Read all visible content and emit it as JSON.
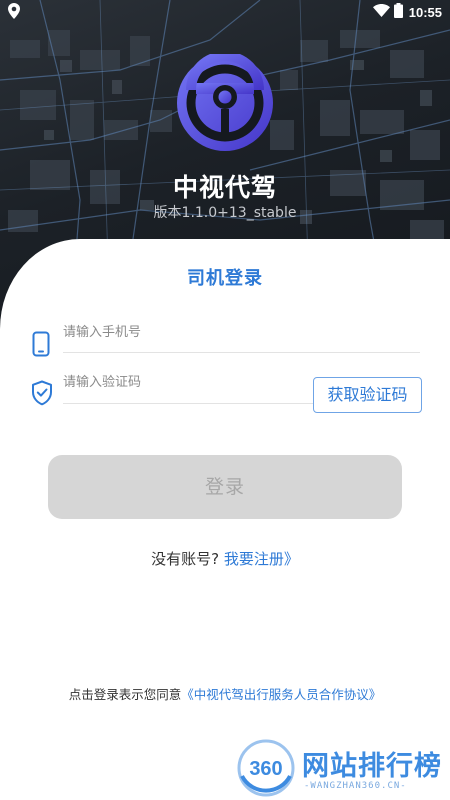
{
  "status_bar": {
    "time": "10:55",
    "icons": [
      "location-icon",
      "wifi-icon",
      "battery-icon"
    ]
  },
  "header": {
    "app_name": "中视代驾",
    "version": "版本1.1.0+13_stable"
  },
  "login": {
    "title": "司机登录",
    "phone_placeholder": "请输入手机号",
    "code_placeholder": "请输入验证码",
    "get_code_label": "获取验证码",
    "login_label": "登录",
    "no_account_text": "没有账号?",
    "register_link": "我要注册》"
  },
  "agreement": {
    "prefix": "点击登录表示您同意",
    "link": "《中视代驾出行服务人员合作协议》"
  },
  "watermark": {
    "badge": "360",
    "title": "网站排行榜",
    "subtitle": "-WANGZHAN360.CN-"
  },
  "colors": {
    "accent": "#2e7ad6",
    "logo_gradient_start": "#6b6df0",
    "logo_gradient_end": "#4a3fd0",
    "button_disabled": "#d6d6d6",
    "hero_dark": "#1c2127"
  }
}
